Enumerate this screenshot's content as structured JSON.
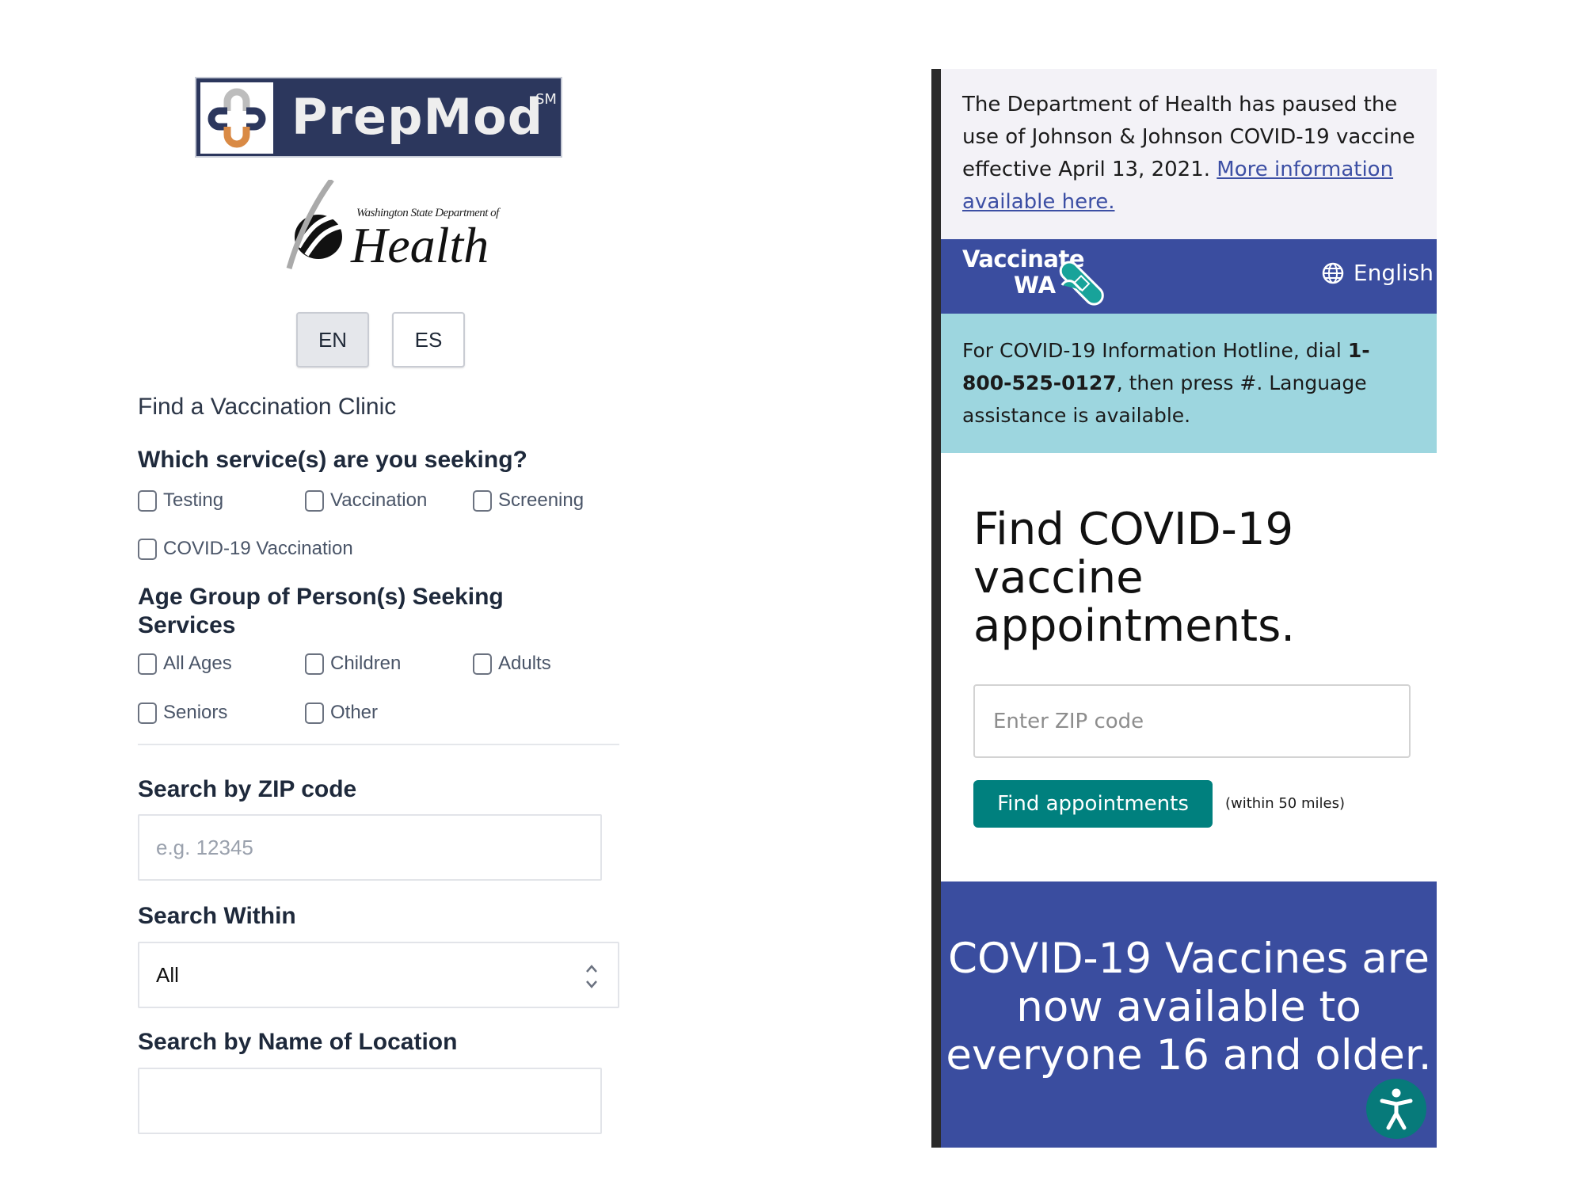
{
  "left_panel": {
    "brand": {
      "name": "PrepMod",
      "mark": "SM"
    },
    "agency_logo": {
      "line1": "Washington State Department of",
      "line2": "Health"
    },
    "language_buttons": [
      {
        "label": "EN",
        "active": true
      },
      {
        "label": "ES",
        "active": false
      }
    ],
    "page_heading": "Find a Vaccination Clinic",
    "services": {
      "label": "Which service(s) are you seeking?",
      "options": [
        "Testing",
        "Vaccination",
        "Screening",
        "COVID-19 Vaccination"
      ]
    },
    "age_group": {
      "label": "Age Group of Person(s) Seeking Services",
      "options": [
        "All Ages",
        "Children",
        "Adults",
        "Seniors",
        "Other"
      ]
    },
    "zip": {
      "label": "Search by ZIP code",
      "placeholder": "e.g. 12345",
      "value": ""
    },
    "within": {
      "label": "Search Within",
      "selected": "All"
    },
    "location": {
      "label": "Search by Name of Location",
      "value": ""
    }
  },
  "right_panel": {
    "notice": {
      "text": "The Department of Health has paused the use of Johnson & Johnson COVID-19 vaccine effective April 13, 2021. ",
      "link": "More information available here."
    },
    "header": {
      "logo_line1": "Vaccinate",
      "logo_line2": "WA",
      "language": "English"
    },
    "hotline": {
      "prefix": "For COVID-19 Information Hotline, dial ",
      "phone": "1-800-525-0127",
      "suffix": ", then press #. Language assistance is available."
    },
    "title": "Find COVID-19 vaccine appointments.",
    "zip_placeholder": "Enter ZIP code",
    "find_button": "Find appointments",
    "radius_note": "(within 50 miles)",
    "promo": "COVID-19 Vaccines are now available to everyone 16 and older.",
    "accessibility_icon": "accessibility-icon"
  },
  "colors": {
    "prepmod_navy": "#2c375d",
    "wa_blue": "#3a4d9f",
    "wa_teal": "#00807e",
    "hotline_bg": "#9dd6df",
    "notice_bg": "#f3f2f7"
  }
}
